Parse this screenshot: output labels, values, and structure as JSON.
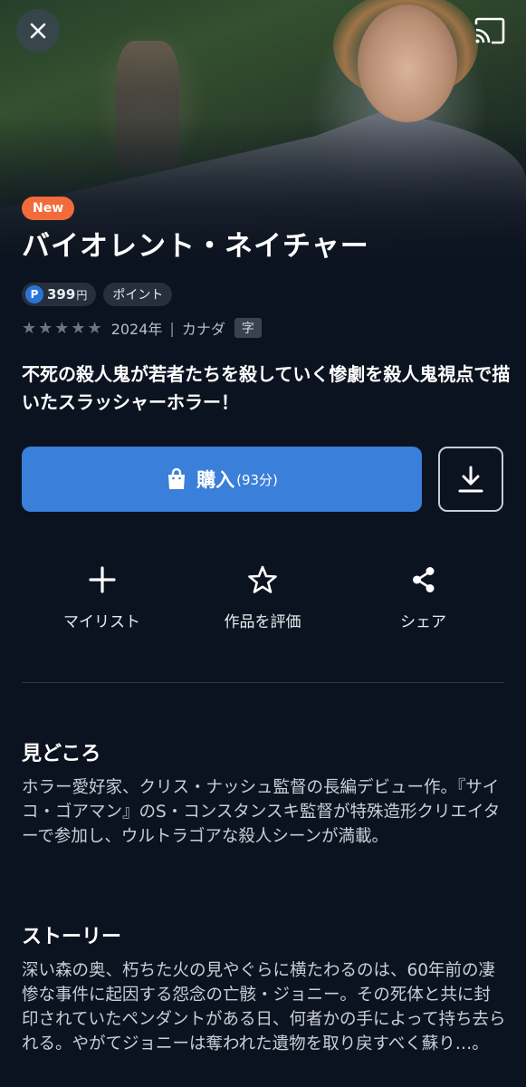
{
  "header": {
    "close_icon": "close-icon",
    "cast_icon": "cast-icon"
  },
  "badge": {
    "label": "New",
    "color": "#f26b3a"
  },
  "title": "バイオレント・ネイチャー",
  "price": {
    "point_symbol": "P",
    "amount": "399",
    "unit": "円",
    "points_label": "ポイント"
  },
  "meta": {
    "stars": "★★★★★",
    "rating_filled": 0,
    "rating_max": 5,
    "year": "2024年",
    "separator": "|",
    "country": "カナダ",
    "subtitle_badge": "字"
  },
  "tagline": "不死の殺人鬼が若者たちを殺していく惨劇を殺人鬼視点で描いたスラッシャーホラー！",
  "buy": {
    "label": "購入",
    "duration": "(93分)",
    "icon": "shopping-bag-icon",
    "color": "#3a7fda"
  },
  "download": {
    "icon": "download-icon"
  },
  "actions": [
    {
      "label": "マイリスト",
      "icon": "plus-icon"
    },
    {
      "label": "作品を評価",
      "icon": "star-icon"
    },
    {
      "label": "シェア",
      "icon": "share-icon"
    }
  ],
  "highlights": {
    "title": "見どころ",
    "body": "ホラー愛好家、クリス・ナッシュ監督の長編デビュー作。『サイコ・ゴアマン』のS・コンスタンスキ監督が特殊造形クリエイターで参加し、ウルトラゴアな殺人シーンが満載。"
  },
  "story": {
    "title": "ストーリー",
    "body": "深い森の奥、朽ちた火の見やぐらに横たわるのは、60年前の凄惨な事件に起因する怨念の亡骸・ジョニー。その死体と共に封印されていたペンダントがある日、何者かの手によって持ち去られる。やがてジョニーは奪われた遺物を取り戻すべく蘇り…。"
  }
}
